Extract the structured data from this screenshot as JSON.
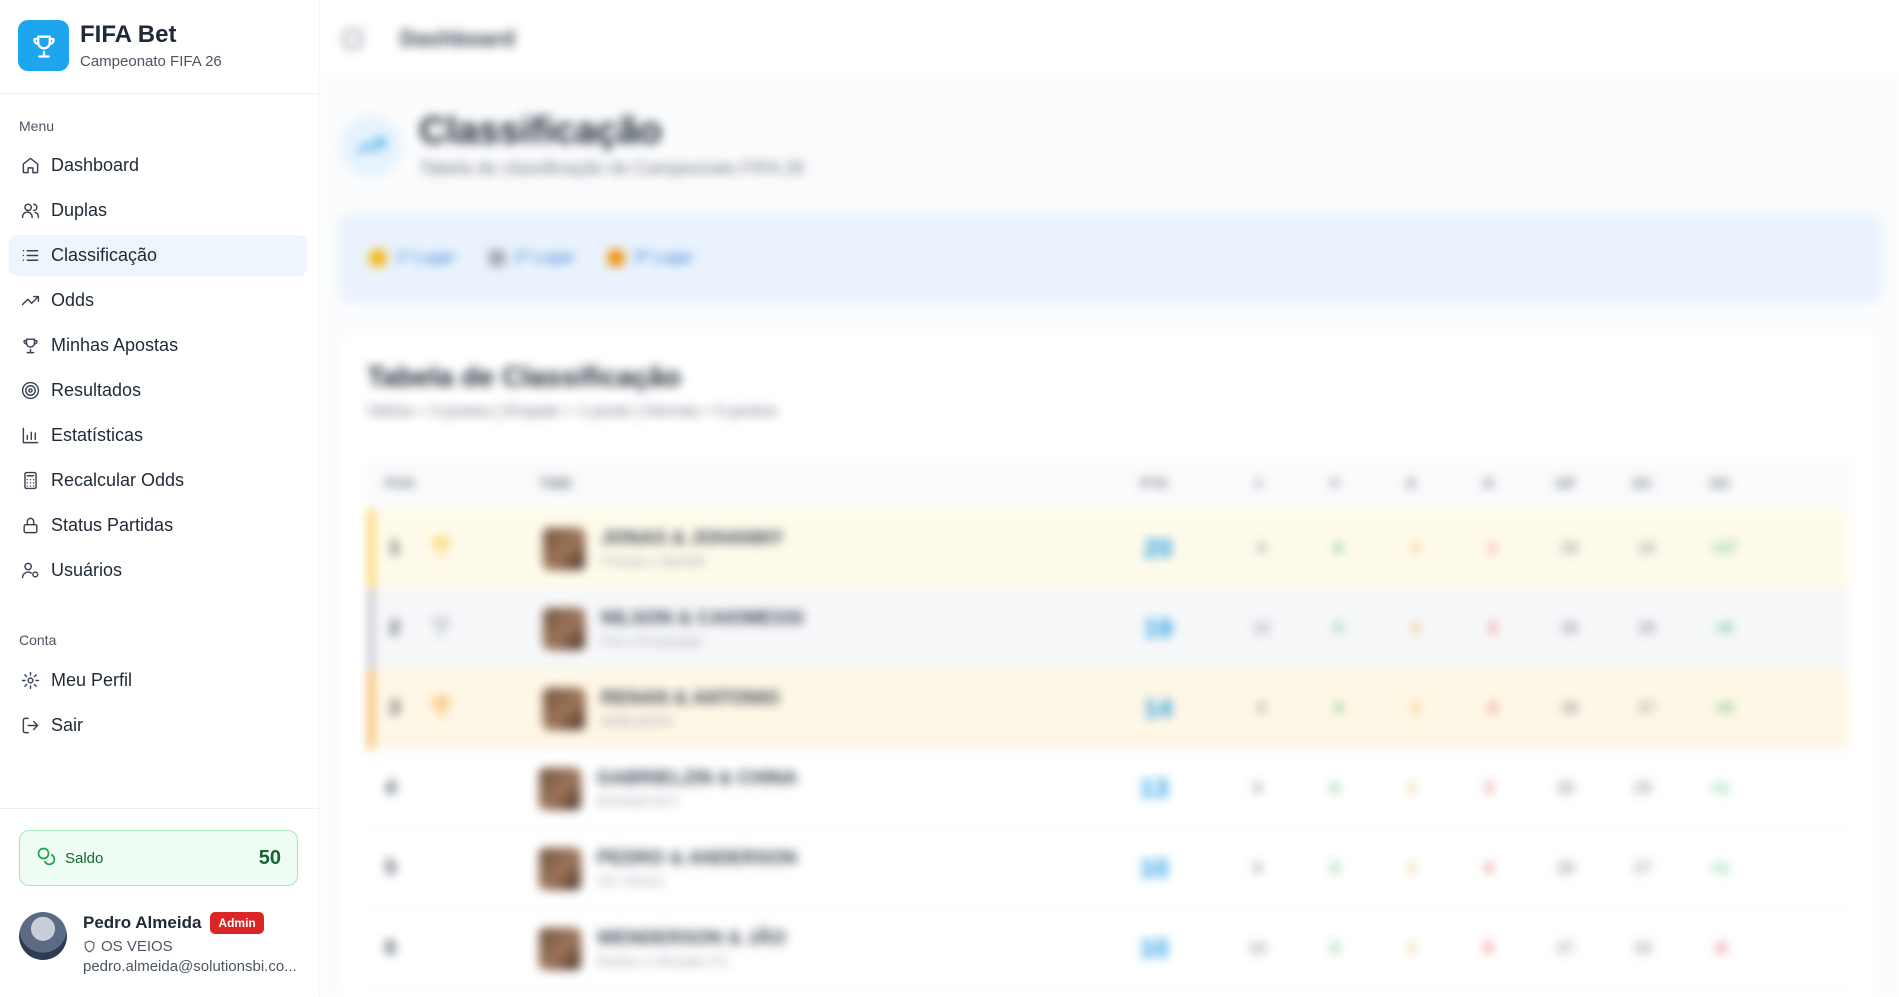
{
  "brand": {
    "title": "FIFA Bet",
    "subtitle": "Campeonato FIFA 26"
  },
  "sidebar": {
    "menu_label": "Menu",
    "items": [
      {
        "label": "Dashboard",
        "icon": "home-icon"
      },
      {
        "label": "Duplas",
        "icon": "users-icon"
      },
      {
        "label": "Classificação",
        "icon": "list-icon",
        "active": true
      },
      {
        "label": "Odds",
        "icon": "trending-up-icon"
      },
      {
        "label": "Minhas Apostas",
        "icon": "trophy-icon"
      },
      {
        "label": "Resultados",
        "icon": "target-icon"
      },
      {
        "label": "Estatísticas",
        "icon": "bar-chart-icon"
      },
      {
        "label": "Recalcular Odds",
        "icon": "calculator-icon"
      },
      {
        "label": "Status Partidas",
        "icon": "lock-icon"
      },
      {
        "label": "Usuários",
        "icon": "user-cog-icon"
      }
    ],
    "account_label": "Conta",
    "account_items": [
      {
        "label": "Meu Perfil",
        "icon": "gear-icon"
      },
      {
        "label": "Sair",
        "icon": "logout-icon"
      }
    ]
  },
  "saldo": {
    "label": "Saldo",
    "value": "50"
  },
  "user": {
    "name": "Pedro Almeida",
    "role": "Admin",
    "team": "OS VEIOS",
    "email": "pedro.almeida@solutionsbi.co..."
  },
  "topbar": {
    "breadcrumb": "Dashboard"
  },
  "page": {
    "title": "Classificação",
    "subtitle": "Tabela de classificação do Campeonato FIFA 26"
  },
  "legend": [
    {
      "label": "1º Lugar",
      "color": "#f5b500"
    },
    {
      "label": "2º Lugar",
      "color": "#9ca3af"
    },
    {
      "label": "3º Lugar",
      "color": "#f08c00"
    }
  ],
  "table": {
    "title": "Tabela de Classificação",
    "subtitle": "Vitória = 3 pontos | Empate = 1 ponto | Derrota = 0 pontos",
    "headers": [
      "POS",
      "TIME",
      "PTS",
      "J",
      "V",
      "E",
      "D",
      "GP",
      "GC",
      "SG"
    ],
    "rows": [
      {
        "pos": "1",
        "name": "JONAS & JOHANNY",
        "sub": "Prompt e Bet365",
        "pts": "20",
        "j": "9",
        "v": "6",
        "e": "2",
        "d": "1",
        "gp": "33",
        "gc": "16",
        "sg": "+17"
      },
      {
        "pos": "2",
        "name": "NILSON & CAIOMESSI",
        "sub": "Pai e Encaixado",
        "pts": "19",
        "j": "12",
        "v": "5",
        "e": "4",
        "d": "3",
        "gp": "36",
        "gc": "28",
        "sg": "+8"
      },
      {
        "pos": "3",
        "name": "RENAN & ANTONIO",
        "sub": "BABUINOS",
        "pts": "14",
        "j": "9",
        "v": "4",
        "e": "2",
        "d": "3",
        "gp": "36",
        "gc": "27",
        "sg": "+9"
      },
      {
        "pos": "4",
        "name": "GABRIELZIN & CHINA",
        "sub": "BAINDEOGY",
        "pts": "13",
        "j": "8",
        "v": "4",
        "e": "1",
        "d": "3",
        "gp": "30",
        "gc": "29",
        "sg": "+1"
      },
      {
        "pos": "5",
        "name": "PEDRO & ANDERSON",
        "sub": "OS VEIOS",
        "pts": "10",
        "j": "8",
        "v": "3",
        "e": "1",
        "d": "4",
        "gp": "28",
        "gc": "27",
        "sg": "+1"
      },
      {
        "pos": "6",
        "name": "WENDERSON & JÃO",
        "sub": "Boteko e Mosaiks FC",
        "pts": "10",
        "j": "10",
        "v": "3",
        "e": "1",
        "d": "6",
        "gp": "27",
        "gc": "33",
        "sg": "-6"
      }
    ]
  }
}
